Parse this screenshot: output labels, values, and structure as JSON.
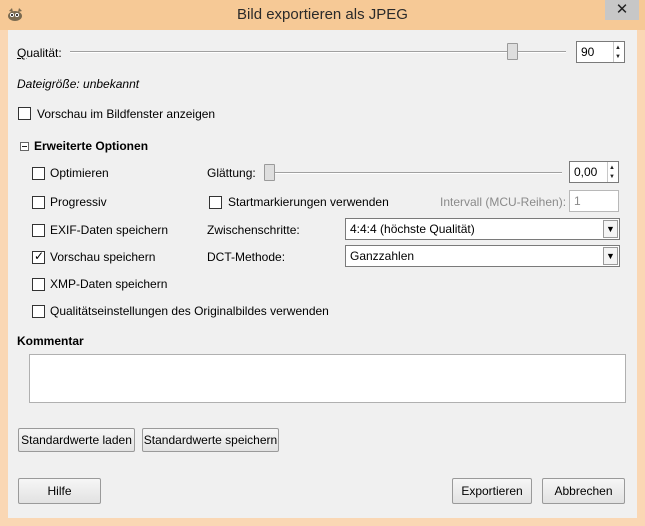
{
  "window": {
    "title": "Bild exportieren als JPEG",
    "close_glyph": "✕"
  },
  "quality": {
    "label": "Qualität:",
    "underline_char": "Q",
    "value": "90",
    "slider_fraction": 0.9
  },
  "filesize": "Dateigröße: unbekannt",
  "preview_in_window": {
    "label": "Vorschau im Bildfenster anzeigen",
    "checked": false
  },
  "advanced": {
    "title": "Erweiterte Optionen",
    "optimize": {
      "label": "Optimieren",
      "checked": false
    },
    "progressive": {
      "label": "Progressiv",
      "checked": false
    },
    "exif": {
      "label": "EXIF-Daten speichern",
      "checked": false
    },
    "thumbnail": {
      "label": "Vorschau speichern",
      "checked": true
    },
    "xmp": {
      "label": "XMP-Daten speichern",
      "checked": false
    },
    "use_original_quality": {
      "label": "Qualitätseinstellungen des Originalbildes verwenden",
      "checked": false
    },
    "smoothing": {
      "label": "Glättung:",
      "value": "0,00",
      "slider_fraction": 0.0
    },
    "restart_markers": {
      "label": "Startmarkierungen verwenden",
      "checked": false
    },
    "interval": {
      "label": "Intervall (MCU-Reihen):",
      "value": "1"
    },
    "subsampling": {
      "label": "Zwischenschritte:",
      "value": "4:4:4 (höchste Qualität)"
    },
    "dct": {
      "label": "DCT-Methode:",
      "value": "Ganzzahlen"
    }
  },
  "comment": {
    "label": "Kommentar",
    "value": ""
  },
  "buttons": {
    "load_defaults": "Standardwerte laden",
    "save_defaults": "Standardwerte speichern",
    "help": "Hilfe",
    "export": "Exportieren",
    "cancel": "Abbrechen"
  },
  "icons": {
    "app": "gimp-wilber-icon",
    "check": "checkmark-icon",
    "spin_up": "spin-up-icon",
    "spin_down": "spin-down-icon",
    "dropdown": "dropdown-arrow-icon"
  }
}
